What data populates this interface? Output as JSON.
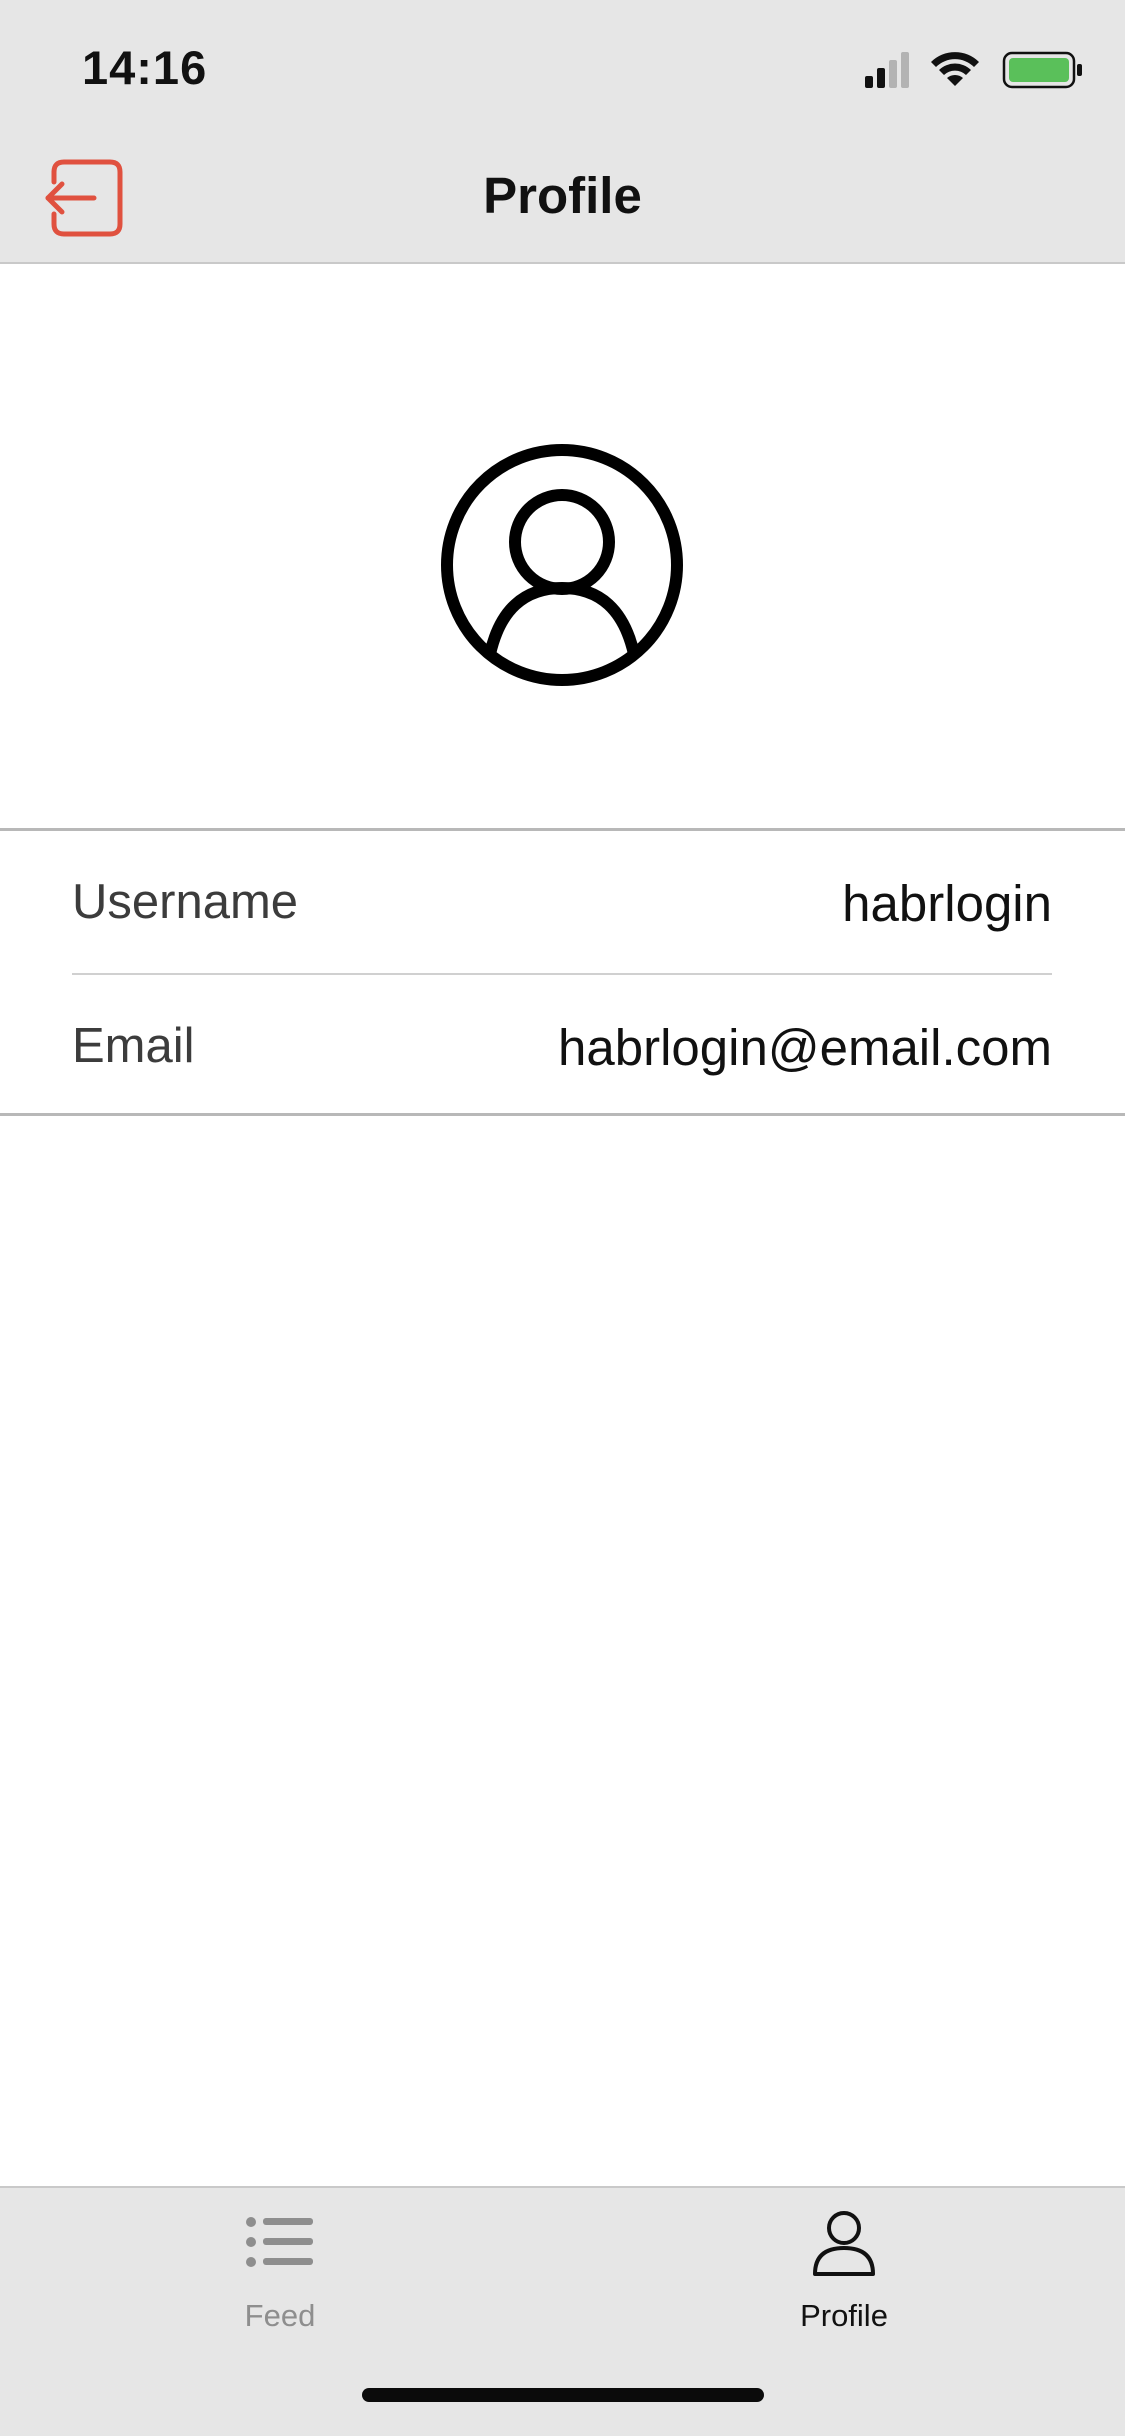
{
  "status_bar": {
    "time": "14:16",
    "icons": [
      "signal-icon",
      "wifi-icon",
      "battery-icon"
    ],
    "battery_color": "#5ac05a"
  },
  "nav": {
    "title": "Profile",
    "left_icon": "logout-icon",
    "accent_color": "#e0513f"
  },
  "profile": {
    "avatar_icon": "person-circle-icon",
    "fields": [
      {
        "label": "Username",
        "value": "habrlogin"
      },
      {
        "label": "Email",
        "value": "habrlogin@email.com"
      }
    ]
  },
  "tabbar": {
    "tabs": [
      {
        "label": "Feed",
        "icon": "list-icon",
        "selected": false
      },
      {
        "label": "Profile",
        "icon": "person-icon",
        "selected": true
      }
    ]
  }
}
